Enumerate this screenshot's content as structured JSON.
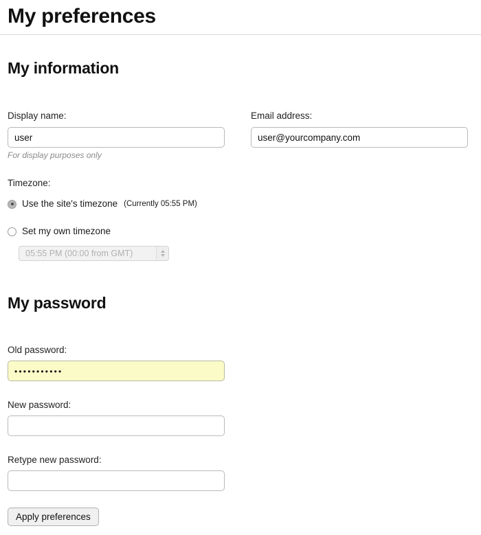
{
  "page": {
    "title": "My preferences"
  },
  "sections": {
    "information": {
      "heading": "My information",
      "display_name": {
        "label": "Display name:",
        "value": "user",
        "hint": "For display purposes only"
      },
      "email": {
        "label": "Email address:",
        "value": "user@yourcompany.com"
      },
      "timezone": {
        "label": "Timezone:",
        "option_site": {
          "label": "Use the site's timezone",
          "note": "(Currently 05:55 PM)",
          "selected": true
        },
        "option_own": {
          "label": "Set my own timezone",
          "selected": false
        },
        "select": {
          "value": "05:55 PM (00:00 from GMT)",
          "disabled": true
        }
      }
    },
    "password": {
      "heading": "My password",
      "old_password": {
        "label": "Old password:",
        "value": "•••••••••••",
        "autofilled": true
      },
      "new_password": {
        "label": "New password:",
        "value": ""
      },
      "retype_password": {
        "label": "Retype new password:",
        "value": ""
      }
    }
  },
  "actions": {
    "apply": "Apply preferences"
  },
  "colors": {
    "autofill_background": "#fbfbc8",
    "input_border": "#b9b9b9",
    "rule": "#d8d8d8",
    "hint_text": "#8a8a8a",
    "button_background": "#f0f0f0"
  }
}
